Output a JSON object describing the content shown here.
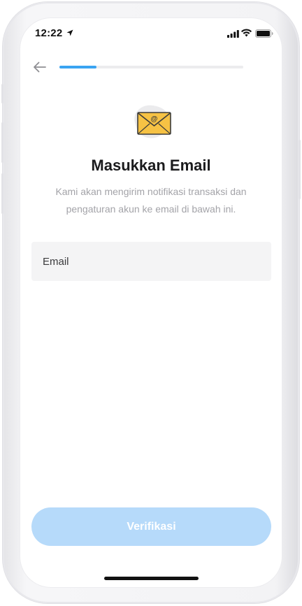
{
  "status_bar": {
    "time": "12:22",
    "icons": [
      "location-arrow-icon",
      "signal-icon",
      "wifi-icon",
      "battery-icon"
    ]
  },
  "header": {
    "back_icon": "arrow-left-icon",
    "progress": 0.2
  },
  "illustration": {
    "icon": "envelope-at-icon",
    "symbol": "@"
  },
  "content": {
    "title": "Masukkan Email",
    "subtitle": "Kami akan mengirim notifikasi transaksi dan pengaturan akun ke email di bawah ini."
  },
  "form": {
    "email_placeholder": "Email",
    "email_value": ""
  },
  "actions": {
    "verify_label": "Verifikasi"
  },
  "colors": {
    "accent": "#3aa4f2",
    "button_disabled": "#b6dafa",
    "envelope": "#f6c244",
    "field_bg": "#f4f4f5",
    "subtitle": "#a3a3a8"
  }
}
